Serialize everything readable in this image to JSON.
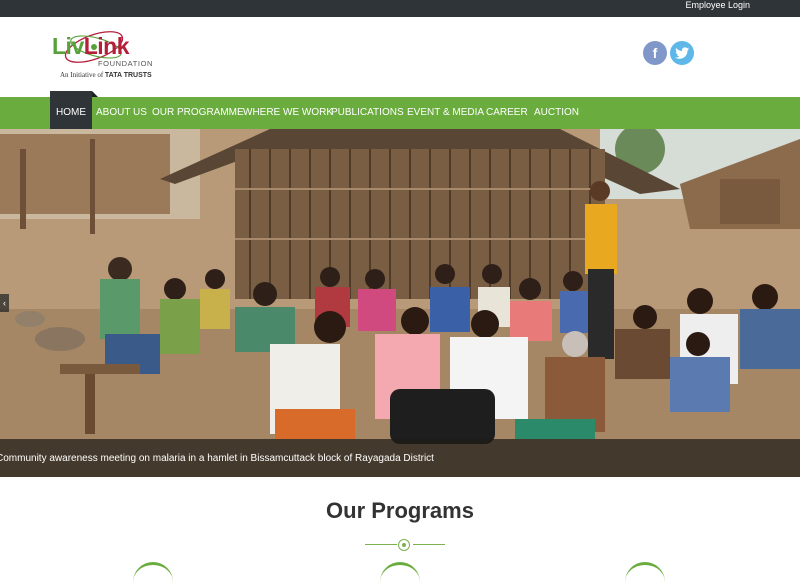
{
  "topbar": {
    "employee_login": "Employee Login"
  },
  "logo": {
    "brand_part1": "Liv",
    "brand_part2": "Link",
    "subtitle": "FOUNDATION",
    "initiative": "An Initiative of",
    "parent": "TATA TRUSTS"
  },
  "social": {
    "facebook": "f",
    "twitter": "t"
  },
  "nav": {
    "items": [
      {
        "label": "HOME",
        "active": true
      },
      {
        "label": "ABOUT US"
      },
      {
        "label": "OUR PROGRAMME"
      },
      {
        "label": "WHERE WE WORK"
      },
      {
        "label": "PUBLICATIONS"
      },
      {
        "label": "EVENT & MEDIA"
      },
      {
        "label": "CAREER"
      },
      {
        "label": "AUCTION"
      }
    ]
  },
  "hero": {
    "caption": "Community awareness meeting on malaria in a hamlet in Bissamcuttack block of Rayagada District"
  },
  "programs": {
    "title": "Our Programs"
  },
  "colors": {
    "accent": "#6aac3e",
    "dark": "#2f3438"
  }
}
